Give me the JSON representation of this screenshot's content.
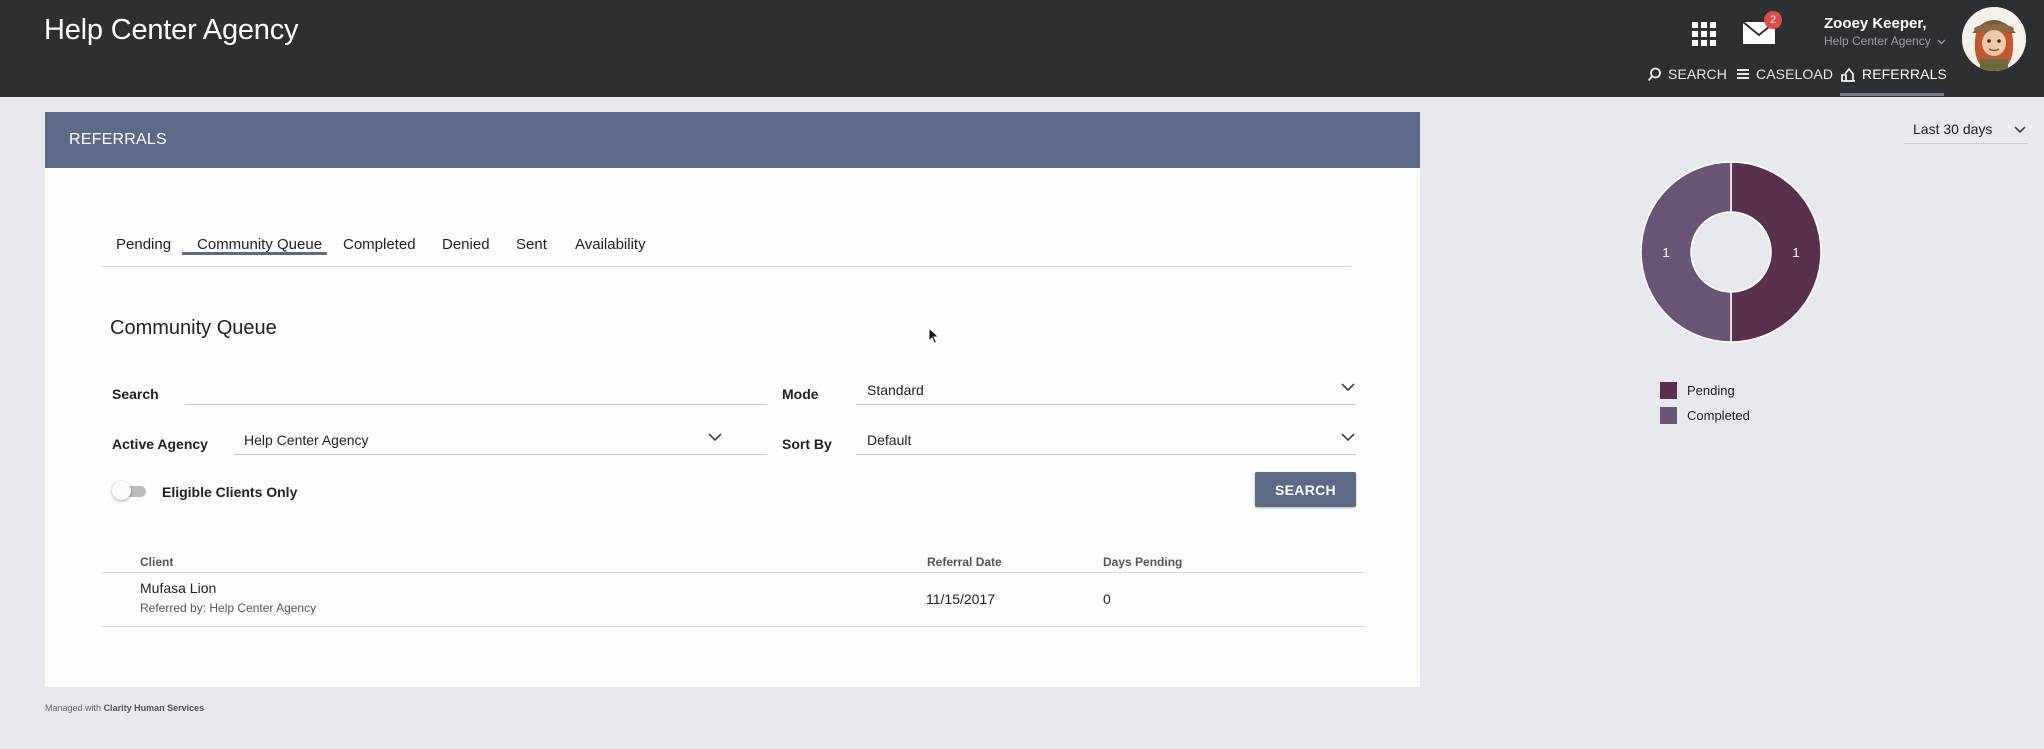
{
  "header": {
    "app_title": "Help Center Agency",
    "mail_count": "2",
    "user_name": "Zooey Keeper,",
    "user_agency": "Help Center Agency",
    "nav": [
      {
        "label": "SEARCH",
        "icon": "search-icon"
      },
      {
        "label": "CASELOAD",
        "icon": "list-icon"
      },
      {
        "label": "REFERRALS",
        "icon": "referrals-icon",
        "active": true
      }
    ]
  },
  "card": {
    "title": "REFERRALS",
    "tabs": [
      "Pending",
      "Community Queue",
      "Completed",
      "Denied",
      "Sent",
      "Availability"
    ],
    "active_tab": "Community Queue",
    "section_title": "Community Queue"
  },
  "form": {
    "search_label": "Search",
    "search_value": "",
    "mode_label": "Mode",
    "mode_value": "Standard",
    "agency_label": "Active Agency",
    "agency_value": "Help Center Agency",
    "sort_label": "Sort By",
    "sort_value": "Default",
    "eligible_label": "Eligible Clients Only",
    "eligible_on": false,
    "search_button": "SEARCH"
  },
  "table": {
    "columns": [
      "Client",
      "Referral Date",
      "Days Pending"
    ],
    "rows": [
      {
        "client": "Mufasa Lion",
        "referred_by": "Referred by: Help Center Agency",
        "date": "11/15/2017",
        "days": "0"
      }
    ]
  },
  "footer": {
    "prefix": "Managed with",
    "brand": "Clarity Human Services"
  },
  "side": {
    "range_value": "Last 30 days",
    "legend": [
      {
        "label": "Pending",
        "color": "#5a304f"
      },
      {
        "label": "Completed",
        "color": "#6b5576"
      }
    ]
  },
  "chart_data": {
    "type": "pie",
    "donut": true,
    "categories": [
      "Pending",
      "Completed"
    ],
    "values": [
      1,
      1
    ],
    "colors": [
      "#5a304f",
      "#6b5576"
    ],
    "legend": "bottom"
  }
}
